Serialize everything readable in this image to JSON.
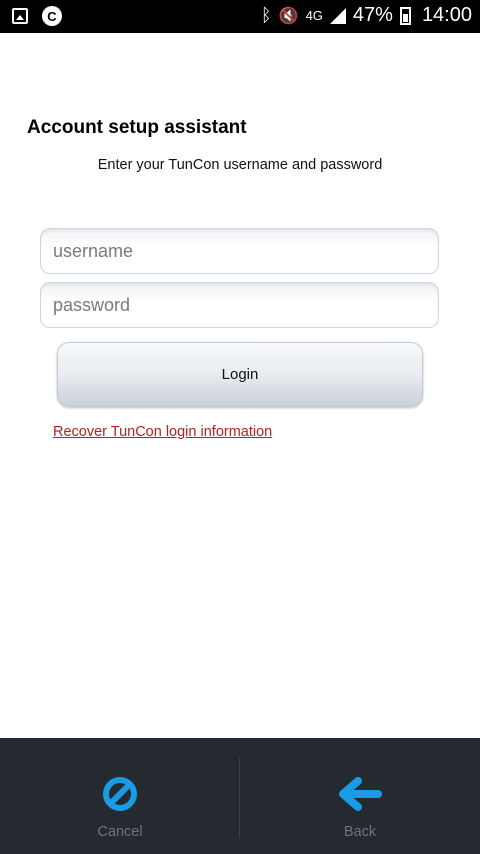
{
  "status_bar": {
    "network": "4G",
    "battery": "47%",
    "time": "14:00"
  },
  "header": {
    "title": "Account setup assistant",
    "subtitle": "Enter your TunCon username and password"
  },
  "form": {
    "username_placeholder": "username",
    "username_value": "",
    "password_placeholder": "password",
    "password_value": "",
    "login_label": "Login",
    "recover_link": "Recover TunCon login information"
  },
  "bottom_nav": {
    "cancel_label": "Cancel",
    "back_label": "Back"
  },
  "colors": {
    "accent": "#1a9be6",
    "link": "#b22222",
    "bottom_bar": "#252a30"
  }
}
